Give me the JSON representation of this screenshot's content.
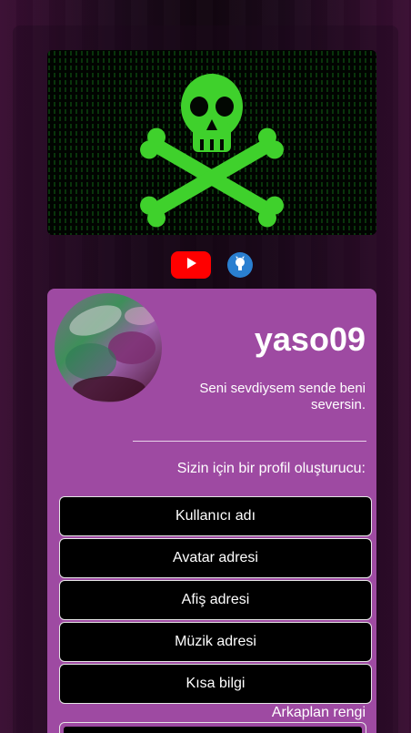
{
  "banner": {
    "image": "skull-crossbones-matrix"
  },
  "socials": [
    {
      "name": "youtube",
      "icon": "youtube-icon"
    },
    {
      "name": "github",
      "icon": "github-icon"
    }
  ],
  "profile": {
    "username": "yaso09",
    "bio": "Seni sevdiysem sende beni seversin.",
    "tagline": "Sizin için bir profil oluşturucu:"
  },
  "fields": [
    {
      "label": "Kullanıcı adı"
    },
    {
      "label": "Avatar adresi"
    },
    {
      "label": "Afiş adresi"
    },
    {
      "label": "Müzik adresi"
    },
    {
      "label": "Kısa bilgi"
    }
  ],
  "background_color": {
    "label": "Arkaplan rengi",
    "value": "#000000"
  },
  "colors": {
    "card": "#9e4aa2",
    "youtube": "#ff0000",
    "github": "#2a7fd0"
  }
}
